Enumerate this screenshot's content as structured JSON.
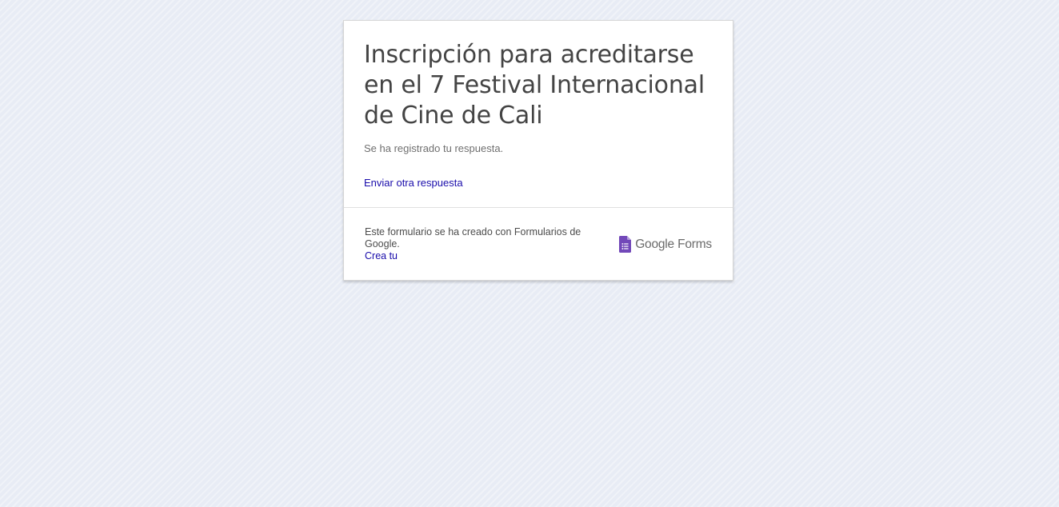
{
  "form": {
    "title": "Inscripción para acreditarse en el 7 Festival Internacional de Cine de Cali",
    "confirmation": "Se ha registrado tu respuesta.",
    "another_response_link": "Enviar otra respuesta"
  },
  "footer": {
    "text": "Este formulario se ha creado con Formularios de Google.",
    "create_link": "Crea tu",
    "brand_name": "Google Forms",
    "brand_icon": "google-forms-icon"
  },
  "colors": {
    "background": "#e8ecf5",
    "link": "#1a0dab",
    "forms_purple": "#7248b9"
  }
}
